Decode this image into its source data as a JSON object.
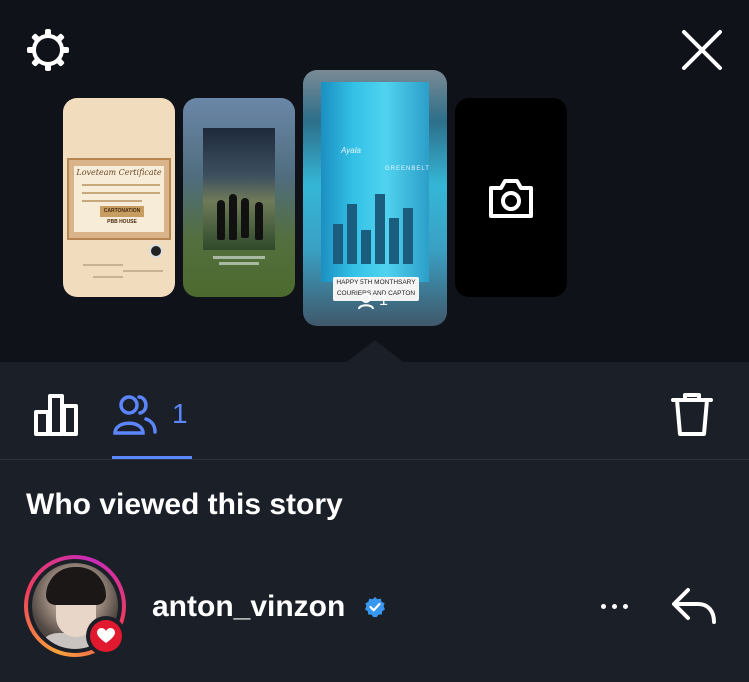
{
  "header": {
    "settings_icon": "gear-icon",
    "close_icon": "close-icon"
  },
  "stories": [
    {
      "kind": "certificate",
      "title": "Loveteam Certificate",
      "stamp": "CARTONATION",
      "house": "PBB HOUSE"
    },
    {
      "kind": "photo"
    },
    {
      "kind": "selected",
      "caption_line1": "HAPPY 5TH MONTHSARY",
      "caption_line2": "COURIERS AND CAPTON",
      "brand_a": "Ayala",
      "brand_b": "GREENBELT",
      "viewers": "1"
    },
    {
      "kind": "add",
      "icon": "camera-icon"
    }
  ],
  "tabs": {
    "stats_icon": "bar-chart-icon",
    "viewers_icon": "people-icon",
    "viewers_count": "1",
    "delete_icon": "trash-icon",
    "accent": "#5c86ff"
  },
  "section": {
    "heading": "Who viewed this story"
  },
  "viewers": [
    {
      "username": "anton_vinzon",
      "verified": true,
      "liked": true,
      "more_icon": "more-icon",
      "reply_icon": "reply-icon"
    }
  ],
  "colors": {
    "background": "#1b1f27",
    "top_background": "#0f1319",
    "like": "#e0192e",
    "verified": "#3897f0"
  }
}
